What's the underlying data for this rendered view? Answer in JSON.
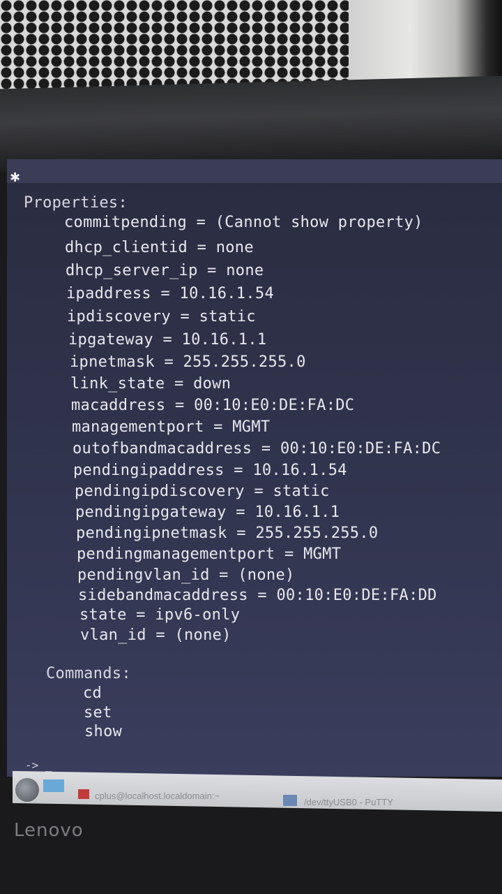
{
  "properties_header": "Properties:",
  "properties": [
    "commitpending = (Cannot show property)",
    "dhcp_clientid = none",
    "dhcp_server_ip = none",
    "ipaddress = 10.16.1.54",
    "ipdiscovery = static",
    "ipgateway = 10.16.1.1",
    "ipnetmask = 255.255.255.0",
    "link_state = down",
    "macaddress = 00:10:E0:DE:FA:DC",
    "managementport = MGMT",
    "outofbandmacaddress = 00:10:E0:DE:FA:DC",
    "pendingipaddress = 10.16.1.54",
    "pendingipdiscovery = static",
    "pendingipgateway = 10.16.1.1",
    "pendingipnetmask = 255.255.255.0",
    "pendingmanagementport = MGMT",
    "pendingvlan_id = (none)",
    "sidebandmacaddress = 00:10:E0:DE:FA:DD",
    "state = ipv6-only",
    "vlan_id = (none)"
  ],
  "commands_header": "Commands:",
  "commands": [
    "cd",
    "set",
    "show"
  ],
  "prompt": "-> _",
  "taskbar": {
    "item1": "cplus@localhost.localdomain:~",
    "item2": "/dev/ttyUSB0 - PuTTY"
  },
  "brand": "Lenovo",
  "colors": {
    "terminal_bg": "#30334c",
    "terminal_text": "#e7e8ee"
  }
}
